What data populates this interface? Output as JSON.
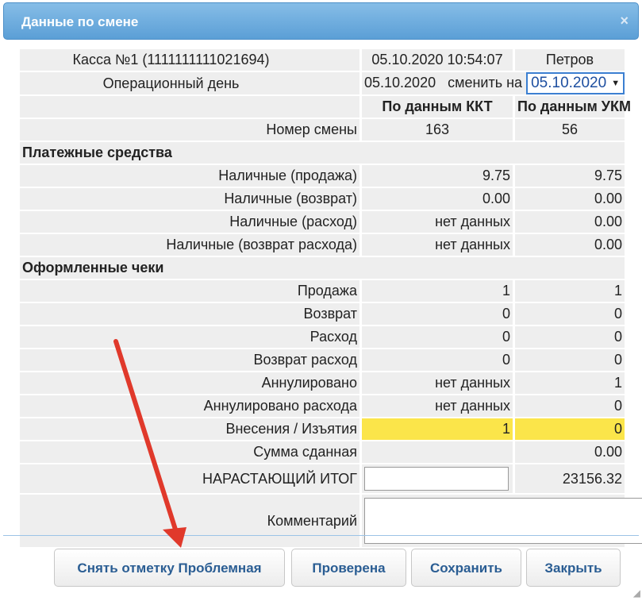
{
  "dialog": {
    "title": "Данные по смене",
    "close_icon": "×"
  },
  "info": {
    "kassa_label": "Касса №1 (1111111111021694)",
    "datetime": "05.10.2020 10:54:07",
    "user": "Петров",
    "opday_label": "Операционный день",
    "opday_date": "05.10.2020",
    "change_label": "сменить на",
    "change_date": "05.10.2020",
    "col_kkt": "По данным ККТ",
    "col_ukm": "По данным УКМ",
    "shift_label": "Номер смены",
    "shift_kkt": "163",
    "shift_ukm": "56"
  },
  "payments": {
    "title": "Платежные средства",
    "rows": [
      {
        "label": "Наличные (продажа)",
        "kkt": "9.75",
        "ukm": "9.75"
      },
      {
        "label": "Наличные (возврат)",
        "kkt": "0.00",
        "ukm": "0.00"
      },
      {
        "label": "Наличные (расход)",
        "kkt": "нет данных",
        "ukm": "0.00"
      },
      {
        "label": "Наличные (возврат расхода)",
        "kkt": "нет данных",
        "ukm": "0.00"
      }
    ]
  },
  "checks": {
    "title": "Оформленные чеки",
    "rows": [
      {
        "label": "Продажа",
        "kkt": "1",
        "ukm": "1"
      },
      {
        "label": "Возврат",
        "kkt": "0",
        "ukm": "0"
      },
      {
        "label": "Расход",
        "kkt": "0",
        "ukm": "0"
      },
      {
        "label": "Возврат расход",
        "kkt": "0",
        "ukm": "0"
      },
      {
        "label": "Аннулировано",
        "kkt": "нет данных",
        "ukm": "1"
      },
      {
        "label": "Аннулировано расхода",
        "kkt": "нет данных",
        "ukm": "0"
      },
      {
        "label": "Внесения / Изъятия",
        "kkt": "1",
        "ukm": "0"
      }
    ]
  },
  "summary": {
    "sum_label": "Сумма сданная",
    "sum_value": "0.00",
    "total_label": "НАРАСТАЮЩИЙ ИТОГ",
    "total_input_value": "",
    "total_value": "23156.32",
    "comment_label": "Комментарий",
    "comment_value": ""
  },
  "buttons": {
    "unmark": "Снять отметку Проблемная",
    "checked": "Проверена",
    "save": "Сохранить",
    "close": "Закрыть"
  },
  "colors": {
    "highlight": "#fbe54a",
    "annotation_arrow": "#e0392b",
    "title_bar": "#5b9fd6"
  }
}
